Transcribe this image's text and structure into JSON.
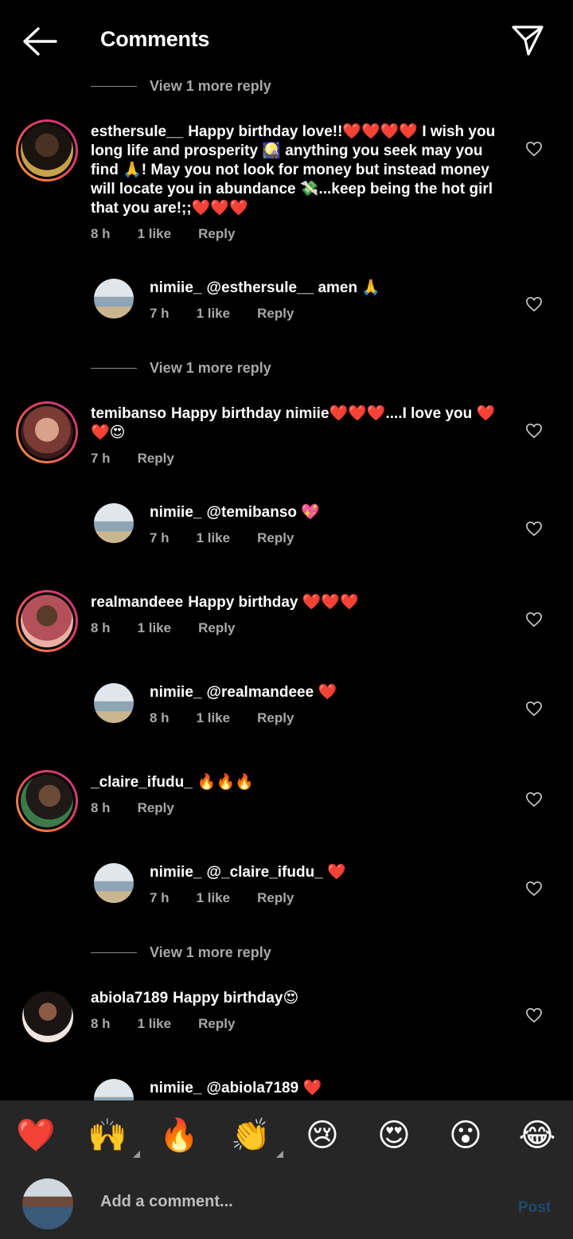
{
  "header": {
    "title": "Comments",
    "back_icon": "arrow-left-icon",
    "send_icon": "paper-plane-icon"
  },
  "view_more_label": "View 1 more reply",
  "comments": [
    {
      "username": "esthersule__",
      "text": "Happy birthday love!!❤️❤️❤️❤️ I wish you long life and prosperity 🎑 anything you seek may you find 🙏! May you not look for money but instead money will locate you in abundance 💸...keep being the hot girl that you are!;;❤️❤️❤️",
      "time": "8 h",
      "likes": "1 like",
      "reply": "Reply"
    },
    {
      "username": "nimiie_",
      "text": "@esthersule__ amen 🙏",
      "time": "7 h",
      "likes": "1 like",
      "reply": "Reply"
    },
    {
      "username": "temibanso",
      "text": "Happy birthday nimiie❤️❤️❤️....I love  you ❤️❤️😍",
      "time": "7 h",
      "reply": "Reply"
    },
    {
      "username": "nimiie_",
      "text": "@temibanso 💖",
      "time": "7 h",
      "likes": "1 like",
      "reply": "Reply"
    },
    {
      "username": "realmandeee",
      "text": "Happy birthday ❤️❤️❤️",
      "time": "8 h",
      "likes": "1 like",
      "reply": "Reply"
    },
    {
      "username": "nimiie_",
      "text": "@realmandeee ❤️",
      "time": "8 h",
      "likes": "1 like",
      "reply": "Reply"
    },
    {
      "username": "_claire_ifudu_",
      "text": "🔥🔥🔥",
      "time": "8 h",
      "reply": "Reply"
    },
    {
      "username": "nimiie_",
      "text": "@_claire_ifudu_ ❤️",
      "time": "7 h",
      "likes": "1 like",
      "reply": "Reply"
    },
    {
      "username": "abiola7189",
      "text": "Happy birthday😍",
      "time": "8 h",
      "likes": "1 like",
      "reply": "Reply"
    },
    {
      "username": "nimiie_",
      "text": "@abiola7189 ❤️"
    }
  ],
  "emoji_bar": [
    "❤️",
    "🙌",
    "🔥",
    "👏",
    "😢",
    "😍",
    "😮",
    "😂"
  ],
  "composer": {
    "placeholder": "Add a comment...",
    "post_label": "Post"
  },
  "colors": {
    "background": "#000000",
    "panel": "#262626",
    "muted_text": "#a8a8a8",
    "post_disabled": "#1c4a72"
  }
}
